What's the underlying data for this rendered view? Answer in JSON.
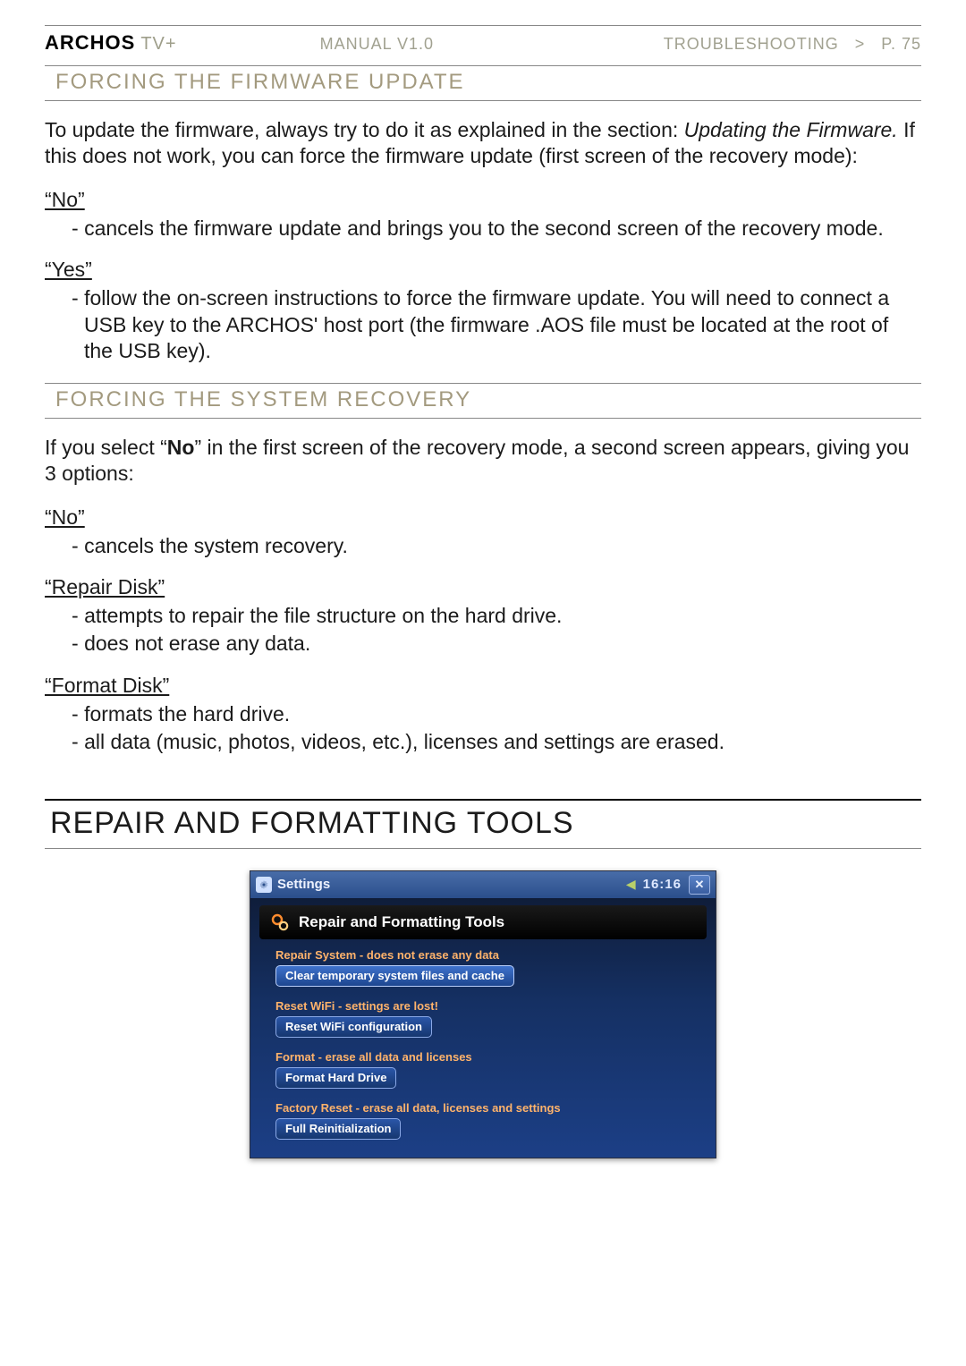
{
  "header": {
    "brand_logo": "ARCHOS",
    "brand_suffix": "TV+",
    "center": "MANUAL V1.0",
    "right": "TROUBLESHOOTING   >   P. 75"
  },
  "sec1": {
    "heading": "FORCING THE FIRMWARE UPDATE",
    "p1_a": "To update the firmware, always try to do it as explained in the section: ",
    "p1_i": "Updating the Firmware.",
    "p1_b": " If this does not work, you can force the firmware update (first screen of the recovery mode):",
    "no_label": "“No”",
    "no_item": "cancels the firmware update and brings you to the second screen of the recovery mode.",
    "yes_label": "“Yes”",
    "yes_item": "follow the on-screen instructions to force the firmware update. You will need to connect a USB key to the ARCHOS' host port (the firmware .AOS file must be located at the root of the USB key)."
  },
  "sec2": {
    "heading": "FORCING THE SYSTEM RECOVERY",
    "p1_a": "If you select “",
    "p1_bold": "No",
    "p1_b": "” in the first screen of the recovery mode, a second screen appears, giving you 3 options:",
    "no_label": "“No”",
    "no_item": "cancels the system recovery.",
    "repair_label": "“Repair Disk”",
    "repair_item1": "attempts to repair the file structure on the hard drive.",
    "repair_item2": "does not erase any data.",
    "format_label": "“Format Disk”",
    "format_item1": "formats the hard drive.",
    "format_item2": "all data (music, photos, videos, etc.), licenses and settings are erased."
  },
  "sec3": {
    "heading": "REPAIR AND FORMATTING TOOLS"
  },
  "device": {
    "title": "Settings",
    "clock": "16:16",
    "panel_title": "Repair and Formatting Tools",
    "groups": [
      {
        "caption": "Repair System - does not erase any data",
        "button": "Clear temporary system files and cache",
        "highlight": true
      },
      {
        "caption": "Reset WiFi - settings are lost!",
        "button": "Reset WiFi configuration",
        "highlight": false
      },
      {
        "caption": "Format - erase all data and licenses",
        "button": "Format Hard Drive",
        "highlight": false
      },
      {
        "caption": "Factory Reset - erase all data, licenses and settings",
        "button": "Full Reinitialization",
        "highlight": false
      }
    ]
  }
}
